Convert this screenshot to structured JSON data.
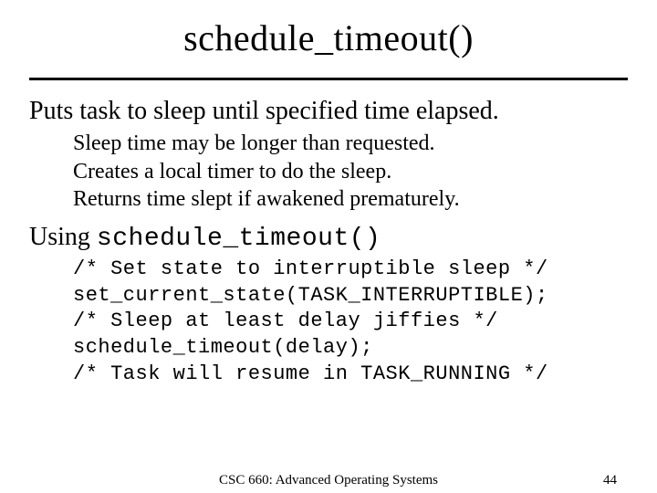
{
  "title": "schedule_timeout()",
  "lead": "Puts task to sleep until specified time elapsed.",
  "sub": {
    "l1": "Sleep time may be longer than requested.",
    "l2": "Creates a local timer to do the sleep.",
    "l3": "Returns time slept if awakened prematurely."
  },
  "using": {
    "prefix": "Using ",
    "fn": "schedule_timeout()"
  },
  "code": {
    "l1": "/* Set state to interruptible sleep */",
    "l2": "set_current_state(TASK_INTERRUPTIBLE);",
    "l3": "/* Sleep at least delay jiffies */",
    "l4": "schedule_timeout(delay);",
    "l5": "/* Task will resume in TASK_RUNNING */"
  },
  "footer": {
    "course": "CSC 660: Advanced Operating Systems",
    "page": "44"
  }
}
